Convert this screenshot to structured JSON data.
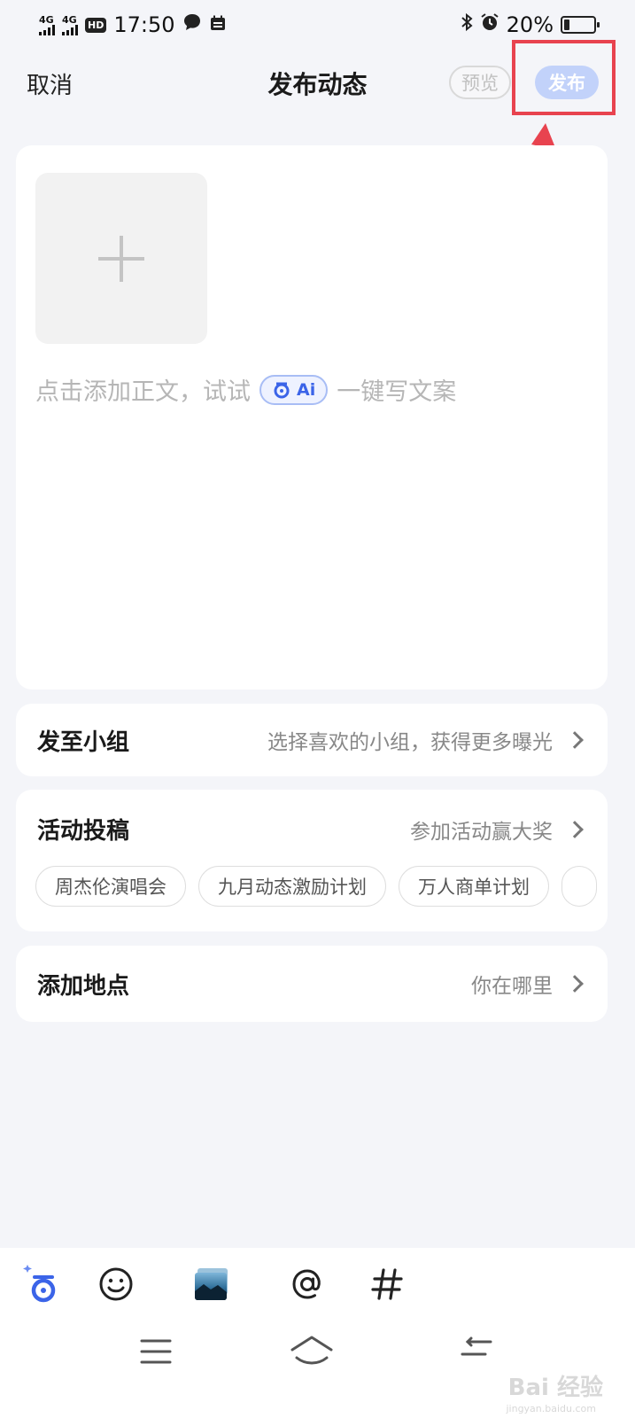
{
  "status_bar": {
    "network_1": "4G",
    "network_2": "4G",
    "hd": "HD",
    "time": "17:50",
    "battery_percent": "20%",
    "battery_level": 0.2
  },
  "nav": {
    "cancel": "取消",
    "title": "发布动态",
    "preview": "预览",
    "publish": "发布"
  },
  "editor": {
    "placeholder_prefix": "点击添加正文，试试",
    "ai_label": "Ai",
    "placeholder_suffix": "一键写文案"
  },
  "group": {
    "title": "发至小组",
    "hint": "选择喜欢的小组，获得更多曝光"
  },
  "activity": {
    "title": "活动投稿",
    "hint": "参加活动赢大奖",
    "chips": [
      "周杰伦演唱会",
      "九月动态激励计划",
      "万人商单计划"
    ]
  },
  "location": {
    "title": "添加地点",
    "hint": "你在哪里"
  },
  "toolbar": {
    "icons": [
      "ai-assistant-icon",
      "emoji-icon",
      "gallery-icon",
      "mention-icon",
      "hashtag-icon"
    ]
  },
  "watermark": {
    "brand": "Bai 经验",
    "site": "jingyan.baidu.com"
  },
  "colors": {
    "accent": "#3b64e8",
    "publish_bg": "#c2d2fa",
    "highlight": "#e8434f",
    "page_bg": "#f4f5f9"
  }
}
